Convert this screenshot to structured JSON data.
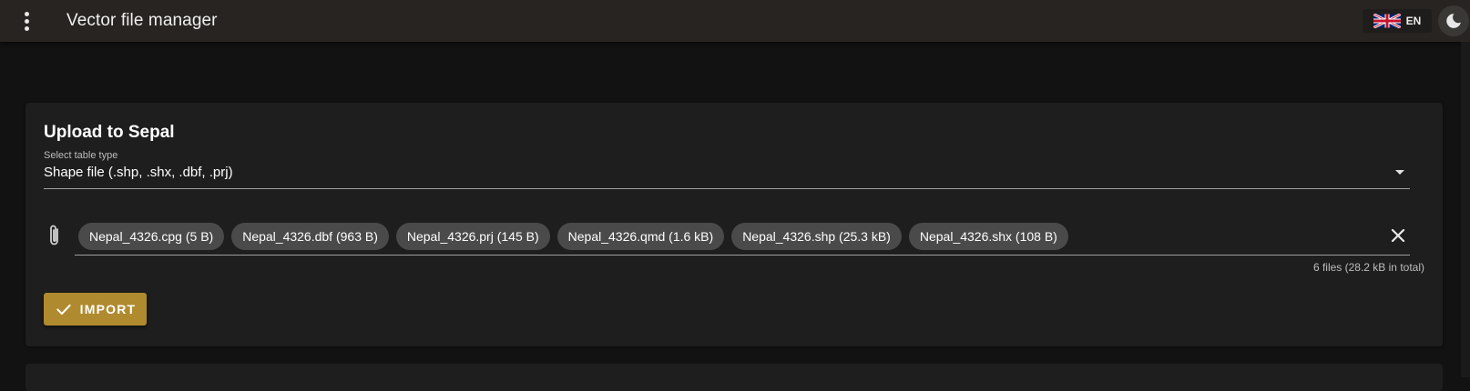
{
  "app": {
    "title": "Vector file manager",
    "menu_icon": "dots-vertical-icon",
    "language": {
      "code": "EN",
      "flag_icon": "uk-flag-icon"
    },
    "theme_icon": "moon-icon"
  },
  "upload_card": {
    "title": "Upload to Sepal",
    "select": {
      "label": "Select table type",
      "value": "Shape file (.shp, .shx, .dbf, .prj)"
    },
    "file_input": {
      "icon": "paperclip-icon",
      "files": [
        "Nepal_4326.cpg (5 B)",
        "Nepal_4326.dbf (963 B)",
        "Nepal_4326.prj (145 B)",
        "Nepal_4326.qmd (1.6 kB)",
        "Nepal_4326.shp (25.3 kB)",
        "Nepal_4326.shx (108 B)"
      ],
      "clear_icon": "close-icon",
      "summary": "6 files (28.2 kB in total)"
    },
    "import_button": {
      "label": "IMPORT",
      "icon": "check-icon"
    }
  },
  "colors": {
    "app_bar": "#272421",
    "background": "#121212",
    "card": "#1e1e1e",
    "chip": "#4a4a4a",
    "accent": "#b08a2e"
  }
}
